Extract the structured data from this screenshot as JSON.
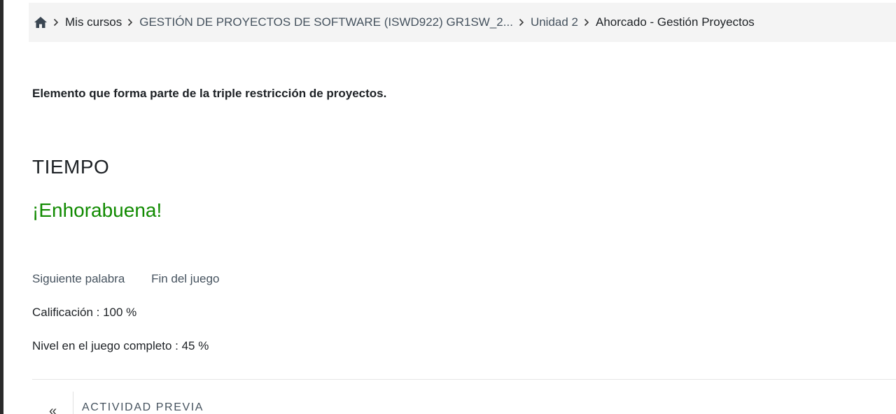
{
  "breadcrumb": {
    "home_icon": "home-icon",
    "separator_icon": "chevron-right-icon",
    "items": [
      {
        "label": "Mis cursos"
      },
      {
        "label": "GESTIÓN DE PROYECTOS DE SOFTWARE (ISWD922) GR1SW_2..."
      },
      {
        "label": "Unidad 2"
      },
      {
        "label": "Ahorcado - Gestión Proyectos"
      }
    ]
  },
  "game": {
    "question": "Elemento que forma parte de la triple restricción de proyectos.",
    "word": "TIEMPO",
    "message": "¡Enhorabuena!",
    "message_color": "#108a00",
    "next_word_label": "Siguiente palabra",
    "end_game_label": "Fin del juego",
    "grade_text": "Calificación : 100 %",
    "level_text": "Nivel en el juego completo : 45 %"
  },
  "navigation": {
    "previous_label": "ACTIVIDAD PREVIA",
    "previous_icon": "double-chevron-left-icon"
  }
}
